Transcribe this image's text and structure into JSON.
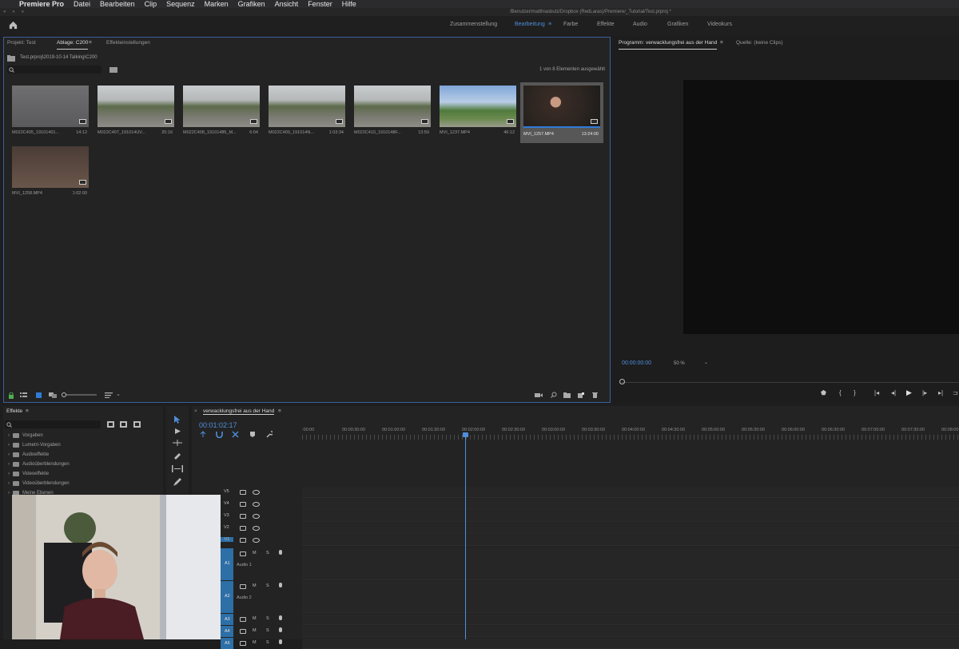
{
  "menubar": {
    "apple": "",
    "items": [
      "Premiere Pro",
      "Datei",
      "Bearbeiten",
      "Clip",
      "Sequenz",
      "Marken",
      "Grafiken",
      "Ansicht",
      "Fenster",
      "Hilfe"
    ]
  },
  "titlebar": {
    "path": "/Benutzer/matthiasbutz/Dropbox (RedLaras)/Premiere/_Tutorial/Test.prproj *"
  },
  "workspaces": {
    "items": [
      "Zusammenstellung",
      "Bearbeitung",
      "Farbe",
      "Effekte",
      "Audio",
      "Grafiken",
      "Videokurs"
    ],
    "active_index": 1,
    "menu_glyph": "≡"
  },
  "project": {
    "tabs": [
      "Projekt: Test",
      "Ablage: C200",
      "Effekteinstellungen"
    ],
    "tab_menu_glyph": "≡",
    "path": "Test.prproj\\2019-10-14 Talking\\C200",
    "selection_info": "1 von 8 Elementen ausgewählt",
    "clips": [
      {
        "name": "M022C405_19101401...",
        "duration": "14:12",
        "theme": "grey"
      },
      {
        "name": "M022C407_191014UV...",
        "duration": "20:16",
        "theme": "road"
      },
      {
        "name": "M022C408_19101485_M...",
        "duration": "6:04",
        "theme": "road"
      },
      {
        "name": "M022C409_191014N...",
        "duration": "1:03:34",
        "theme": "road"
      },
      {
        "name": "M022C410_1910148F...",
        "duration": "13:50",
        "theme": "road"
      },
      {
        "name": "MVI_1237.MP4",
        "duration": "46:12",
        "theme": "sky"
      },
      {
        "name": "MVI_1257.MP4",
        "duration": "13:24:00",
        "theme": "person"
      },
      {
        "name": "MVI_1258.MP4",
        "duration": "1:02:00",
        "theme": "skin"
      }
    ],
    "selected_index": 6
  },
  "program": {
    "tabs": [
      "Programm: verwacklungsfrei aus der Hand",
      "Quelle: (keine Clips)"
    ],
    "tab_menu_glyph": "≡",
    "timecode": "00:00:00:00",
    "zoom": "50 %"
  },
  "effects": {
    "title": "Effekte",
    "menu_glyph": "≡",
    "items": [
      "Vorgaben",
      "Lumetri-Vorgaben",
      "Audioeffekte",
      "Audioüberblendungen",
      "Videoeffekte",
      "Videoüberblendungen",
      "Meine Ebenen"
    ]
  },
  "timeline": {
    "sequence_name": "verwacklungsfrei aus der Hand",
    "menu_glyph": "≡",
    "close_glyph": "×",
    "timecode": "00:01:02:17",
    "playhead_label_index": 2,
    "ruler": [
      ":00:00",
      "00:00:30:00",
      "00:01:00:00",
      "00:01:30:00",
      "00:02:00:00",
      "00:02:30:00",
      "00:03:00:00",
      "00:03:30:00",
      "00:04:00:00",
      "00:04:30:00",
      "00:05:00:00",
      "00:05:30:00",
      "00:06:00:00",
      "00:06:30:00",
      "00:07:00:00",
      "00:07:30:00",
      "00:08:00:00"
    ],
    "video_tracks": [
      "V5",
      "V4",
      "V3",
      "V2",
      "V1"
    ],
    "audio_tracks": [
      {
        "label": "A1",
        "name": "Audio 1"
      },
      {
        "label": "A2",
        "name": "Audio 2"
      },
      {
        "label": "A3",
        "name": ""
      },
      {
        "label": "A4",
        "name": ""
      },
      {
        "label": "A5",
        "name": ""
      }
    ],
    "m_label": "M",
    "s_label": "S"
  },
  "colors": {
    "accent": "#4f8edb",
    "panel_bg": "#232323",
    "focus_border": "#3b5f99",
    "track_target": "#2d6fa7"
  }
}
